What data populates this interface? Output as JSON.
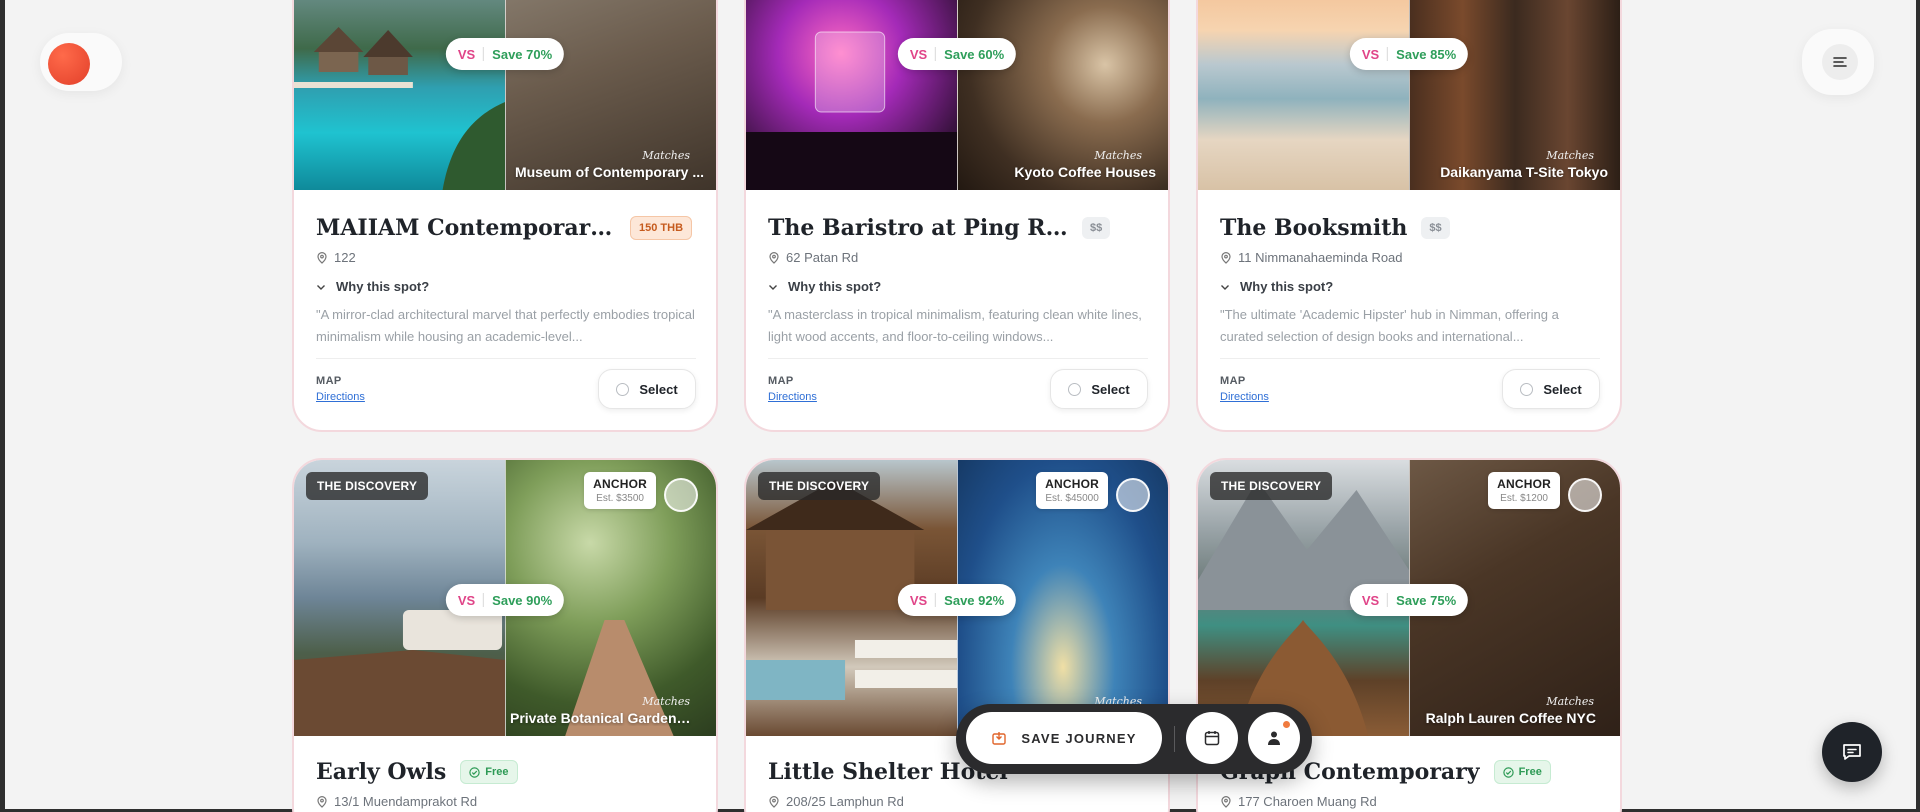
{
  "header": {
    "logo_icon": "brand-dot-icon",
    "menu_icon": "menu-lines-icon"
  },
  "cards": [
    {
      "vs": "VS",
      "save": "Save 70%",
      "matches": "Matches",
      "match_name": "Museum of Contemporary ...",
      "title": "MAIIAM Contemporary Art ...",
      "price": "150 THB",
      "address": "122",
      "why": "Why this spot?",
      "description": "\"A mirror-clad architectural marvel that perfectly embodies tropical minimalism while housing an academic-level...",
      "map_label": "MAP",
      "directions": "Directions",
      "select": "Select"
    },
    {
      "vs": "VS",
      "save": "Save 60%",
      "matches": "Matches",
      "match_name": "Kyoto Coffee Houses",
      "title": "The Baristro at Ping River",
      "price": "$$",
      "address": "62 Patan Rd",
      "why": "Why this spot?",
      "description": "\"A masterclass in tropical minimalism, featuring clean white lines, light wood accents, and floor-to-ceiling windows...",
      "map_label": "MAP",
      "directions": "Directions",
      "select": "Select"
    },
    {
      "vs": "VS",
      "save": "Save 85%",
      "matches": "Matches",
      "match_name": "Daikanyama T-Site Tokyo",
      "title": "The Booksmith",
      "price": "$$",
      "address": "11 Nimmanahaeminda Road",
      "why": "Why this spot?",
      "description": "\"The ultimate 'Academic Hipster' hub in Nimman, offering a curated selection of design books and international...",
      "map_label": "MAP",
      "directions": "Directions",
      "select": "Select"
    },
    {
      "discovery": "THE DISCOVERY",
      "anchor": "ANCHOR",
      "anchor_est": "Est. $3500",
      "vs": "VS",
      "save": "Save 90%",
      "matches": "Matches",
      "match_name": "Private Botanical Garden E...",
      "title": "Early Owls",
      "price": "Free",
      "address": "13/1 Muendamprakot Rd"
    },
    {
      "discovery": "THE DISCOVERY",
      "anchor": "ANCHOR",
      "anchor_est": "Est. $45000",
      "vs": "VS",
      "save": "Save 92%",
      "matches": "Matches",
      "match_name": "",
      "title": "Little Shelter Hotel",
      "price": "",
      "address": "208/25 Lamphun Rd"
    },
    {
      "discovery": "THE DISCOVERY",
      "anchor": "ANCHOR",
      "anchor_est": "Est. $1200",
      "vs": "VS",
      "save": "Save 75%",
      "matches": "Matches",
      "match_name": "Ralph Lauren Coffee NYC",
      "title": "Graph Contemporary",
      "price": "Free",
      "address": "177 Charoen Muang Rd"
    }
  ],
  "dock": {
    "save_journey": "SAVE JOURNEY",
    "calendar_icon": "calendar-icon",
    "user_icon": "user-icon"
  },
  "chat": {
    "icon": "chat-icon"
  }
}
